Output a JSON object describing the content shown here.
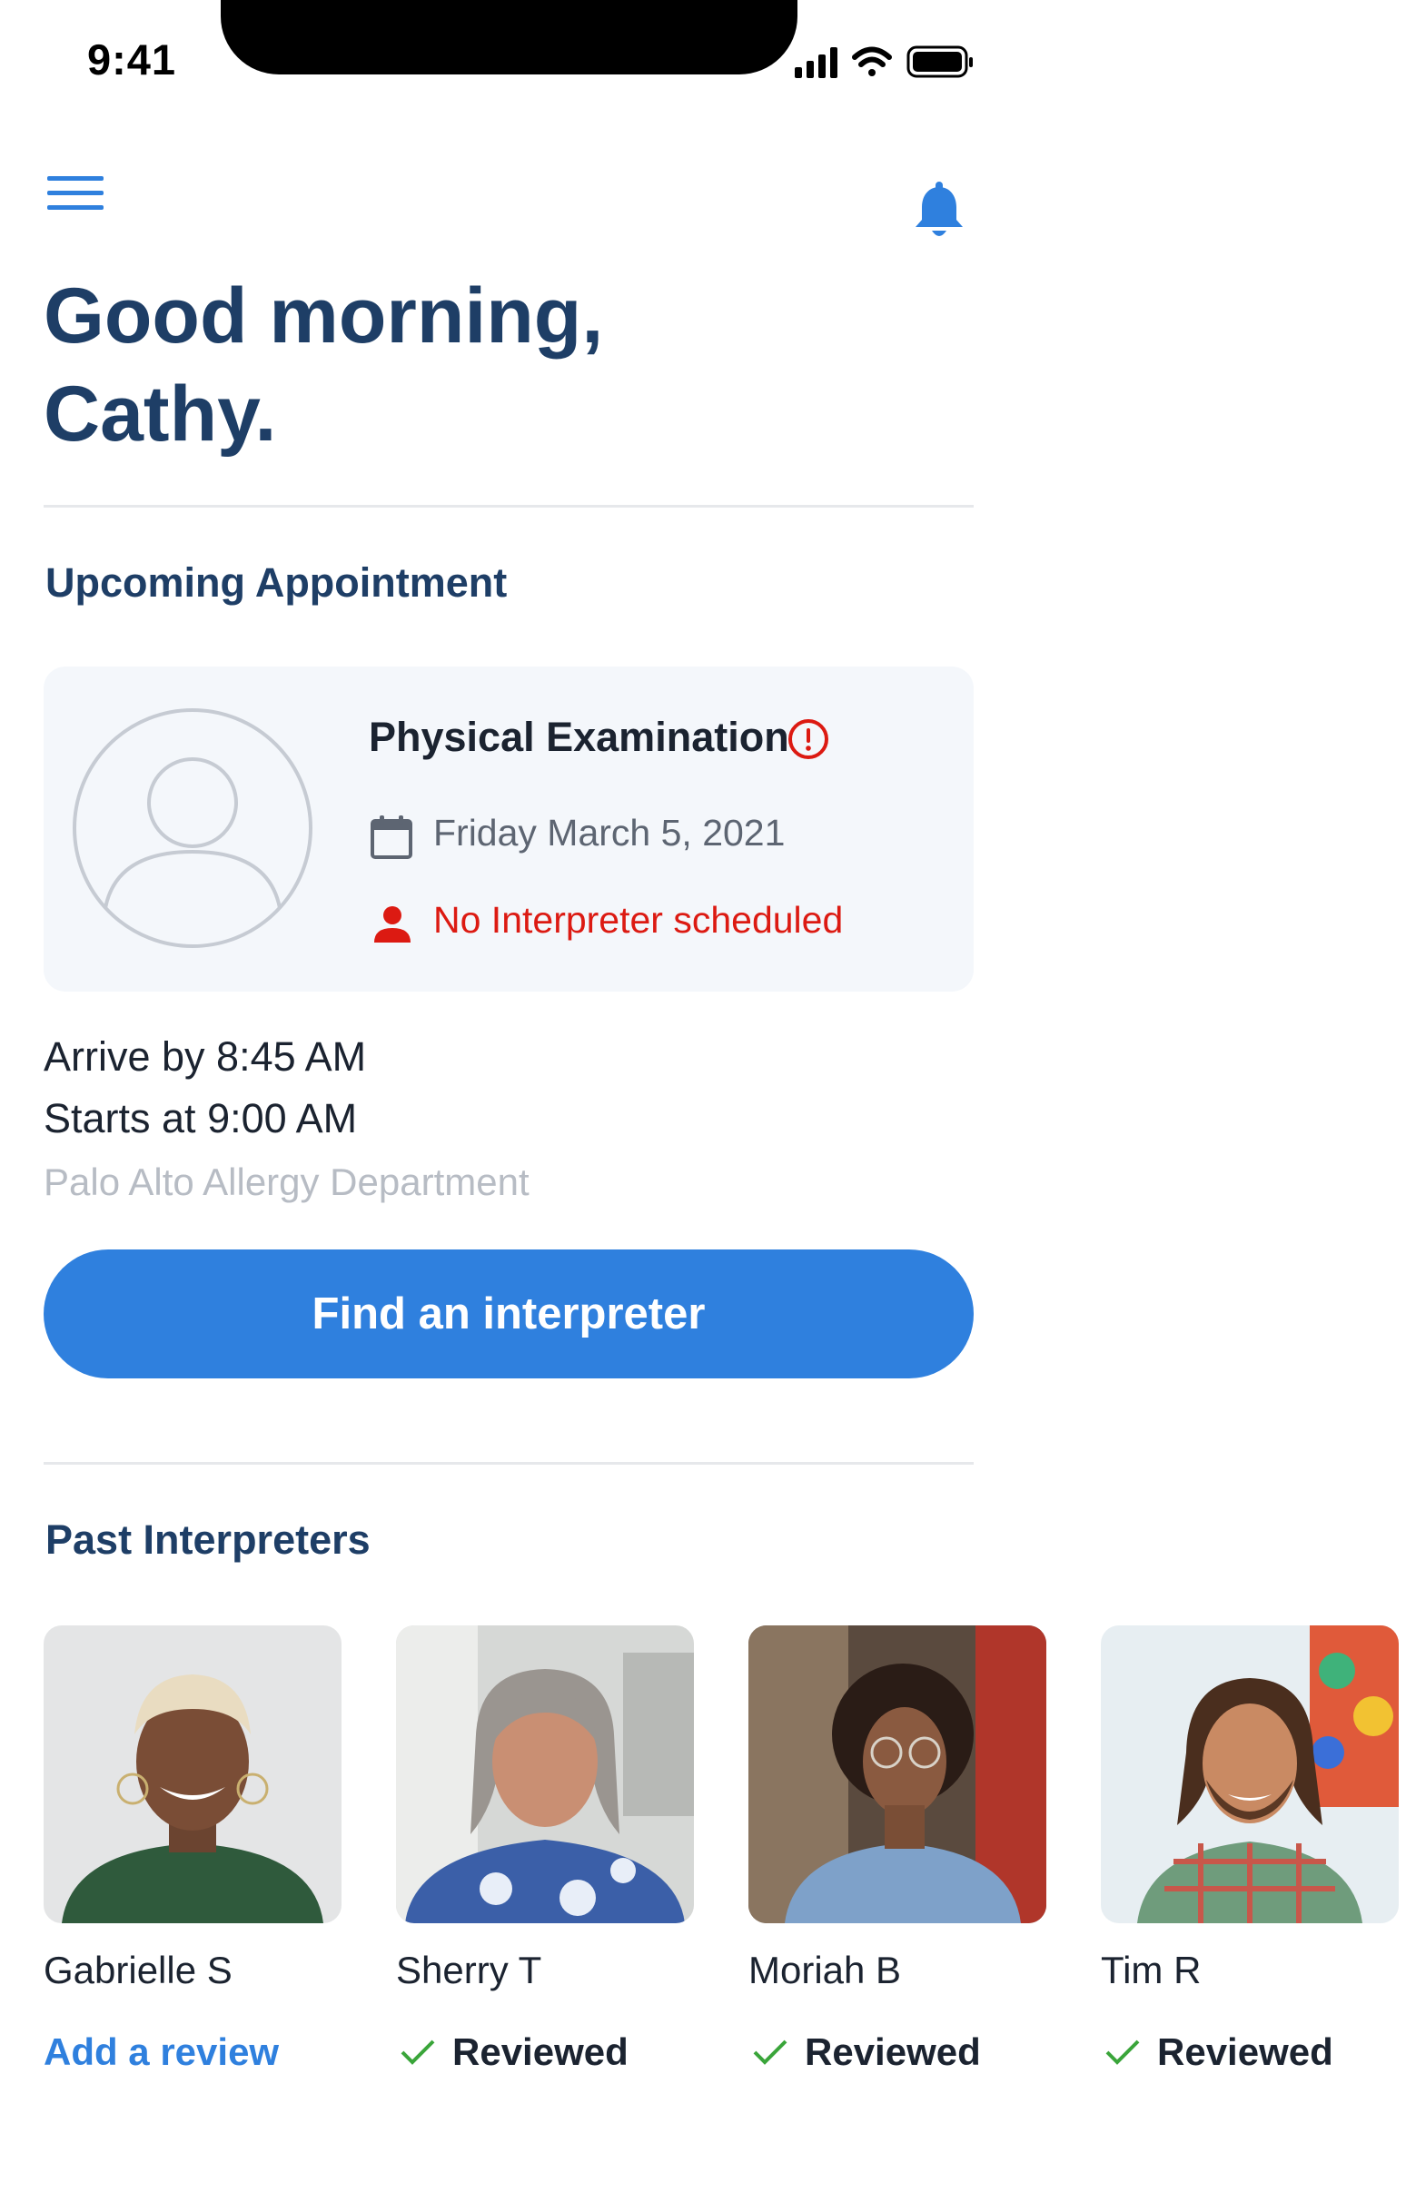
{
  "status_bar": {
    "time": "9:41"
  },
  "greeting": {
    "line1": "Good morning,",
    "line2": "Cathy."
  },
  "upcoming": {
    "section_title": "Upcoming Appointment",
    "appointment": {
      "title": "Physical Examination",
      "date": "Friday March 5, 2021",
      "warning": "No Interpreter scheduled",
      "arrive": "Arrive by 8:45 AM",
      "starts": "Starts at 9:00 AM",
      "location": "Palo Alto Allergy Department"
    },
    "cta_label": "Find an interpreter"
  },
  "past": {
    "section_title": "Past Interpreters",
    "interpreters": [
      {
        "name": "Gabrielle S",
        "action": "Add a review"
      },
      {
        "name": "Sherry T",
        "status": "Reviewed"
      },
      {
        "name": "Moriah B",
        "status": "Reviewed"
      },
      {
        "name": "Tim R",
        "status": "Reviewed"
      }
    ]
  },
  "colors": {
    "accent": "#2f80de",
    "heading": "#1e3e66",
    "warning": "#dc1a12",
    "success": "#3aa53a",
    "card_bg": "#f4f7fb"
  }
}
